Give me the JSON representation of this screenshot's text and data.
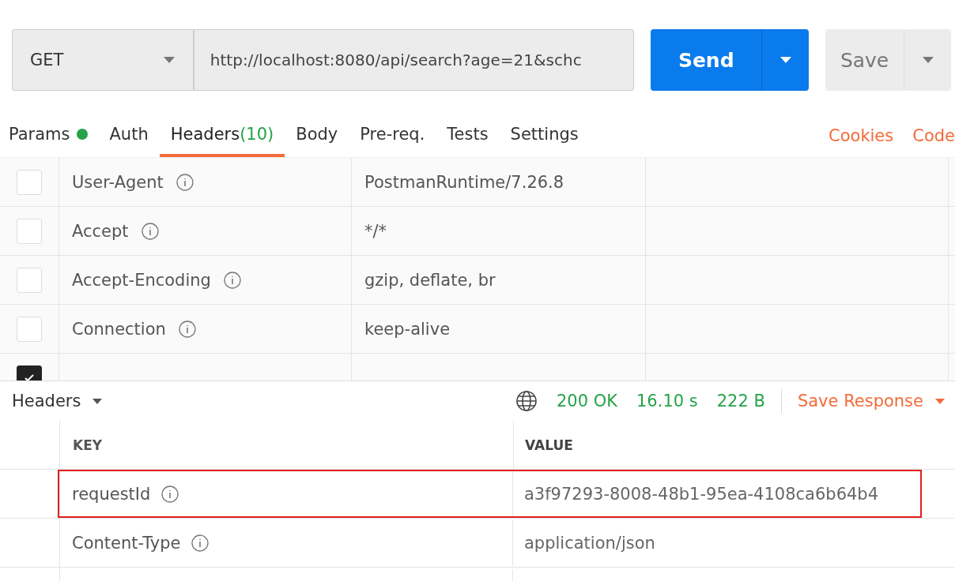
{
  "request": {
    "method": "GET",
    "url": "http://localhost:8080/api/search?age=21&schc",
    "send_label": "Send",
    "save_label": "Save"
  },
  "tabs": [
    {
      "label": "Params",
      "dot": true,
      "selected": false
    },
    {
      "label": "Auth",
      "dot": false,
      "selected": false
    },
    {
      "label": "Headers",
      "dot": false,
      "count": "(10)",
      "selected": true
    },
    {
      "label": "Body",
      "dot": false,
      "selected": false
    },
    {
      "label": "Pre-req.",
      "dot": false,
      "selected": false
    },
    {
      "label": "Tests",
      "dot": false,
      "selected": false
    },
    {
      "label": "Settings",
      "dot": false,
      "selected": false
    }
  ],
  "links": [
    "Cookies",
    "Code"
  ],
  "request_headers": [
    {
      "key": "User-Agent",
      "value": "PostmanRuntime/7.26.8",
      "checked": false
    },
    {
      "key": "Accept",
      "value": "*/*",
      "checked": false
    },
    {
      "key": "Accept-Encoding",
      "value": "gzip, deflate, br",
      "checked": false
    },
    {
      "key": "Connection",
      "value": "keep-alive",
      "checked": false
    },
    {
      "checked": true
    }
  ],
  "response": {
    "section": "Headers",
    "status": "200 OK",
    "time": "16.10 s",
    "size": "222 B",
    "save_label": "Save Response",
    "columns": [
      "KEY",
      "VALUE"
    ],
    "rows": [
      {
        "key": "requestId",
        "value": "a3f97293-8008-48b1-95ea-4108ca6b64b4",
        "highlighted": true
      },
      {
        "key": "Content-Type",
        "value": "application/json",
        "highlighted": false
      },
      {
        "highlighted": false
      }
    ]
  }
}
